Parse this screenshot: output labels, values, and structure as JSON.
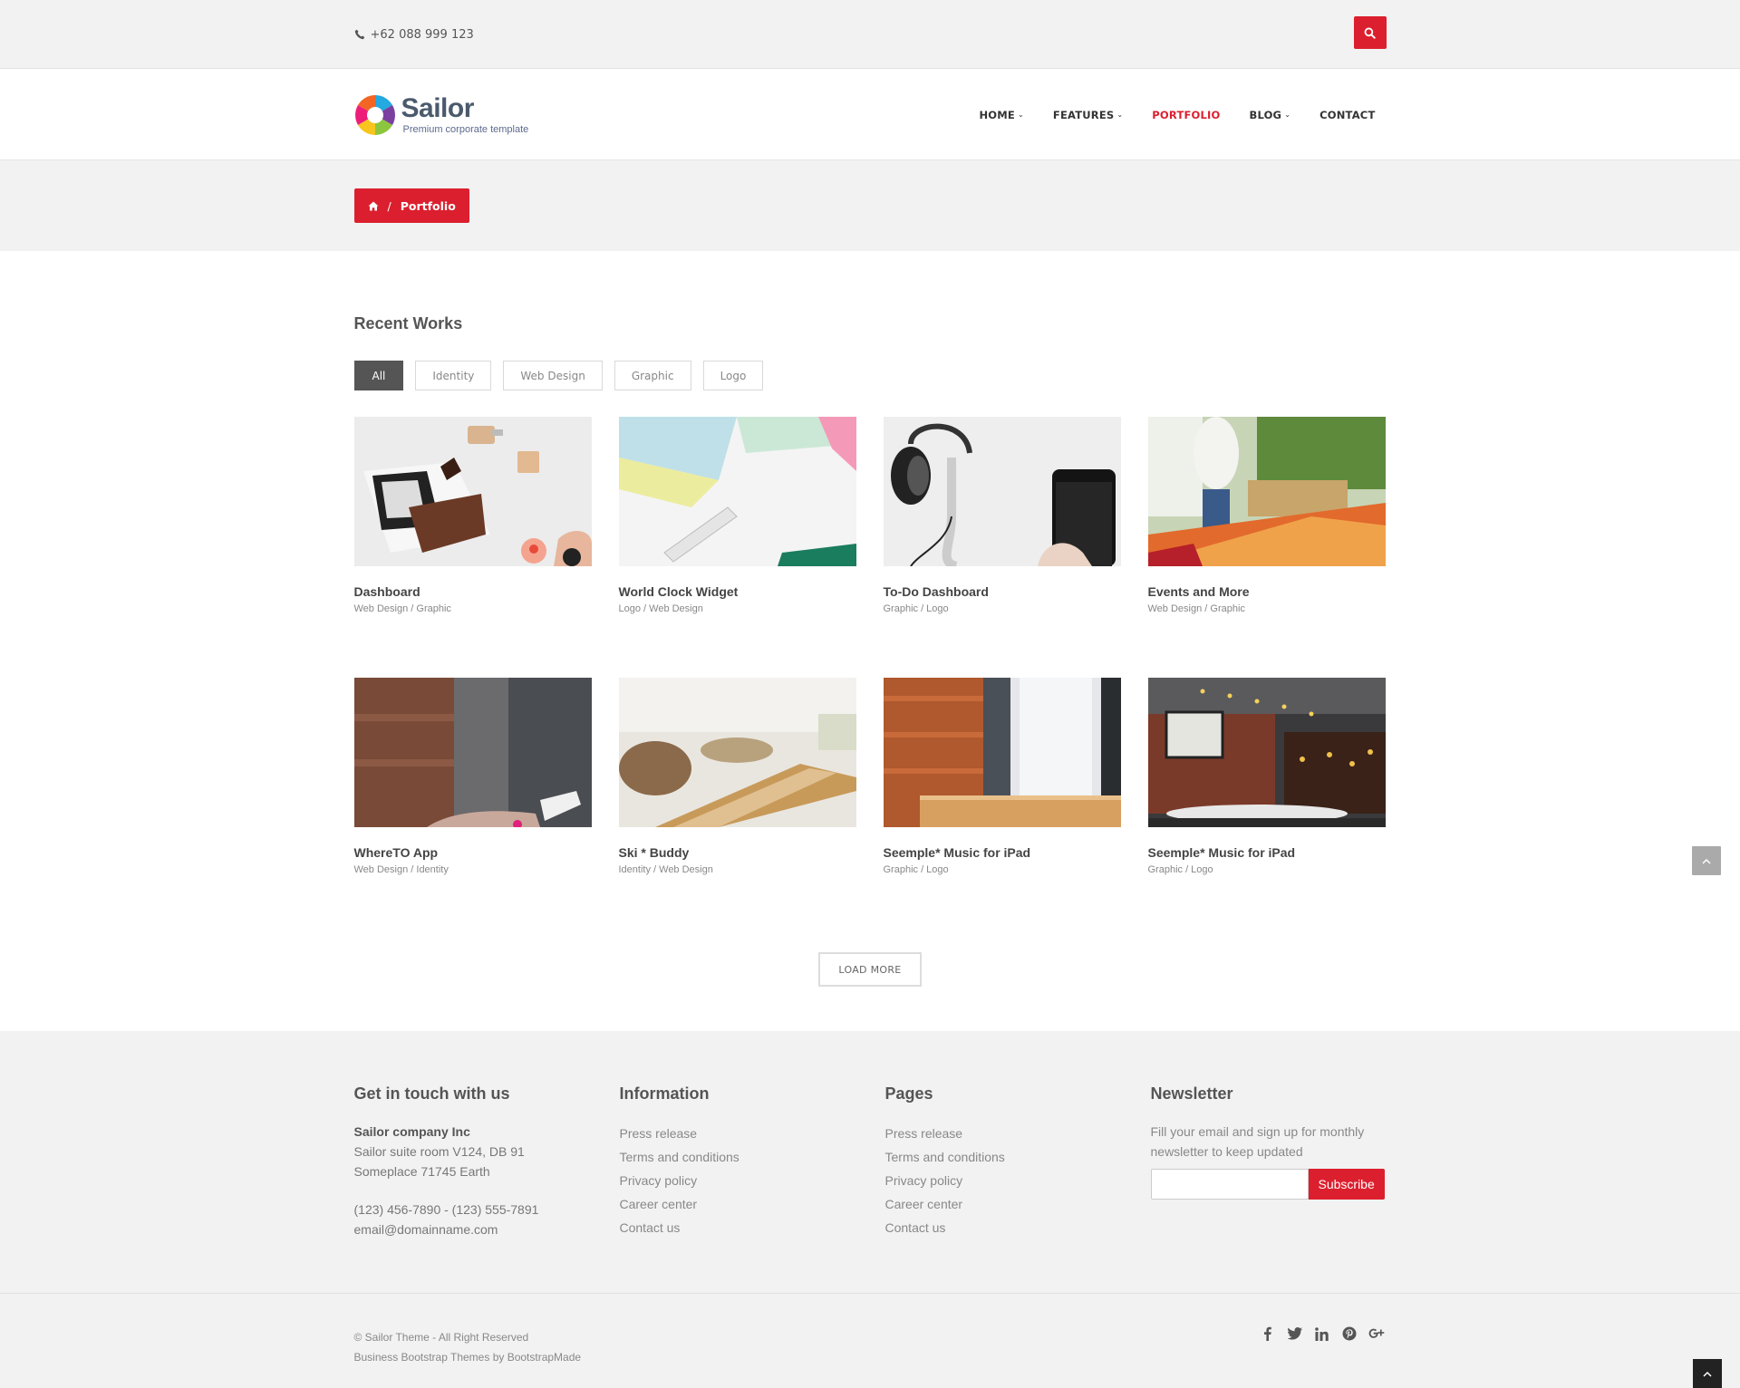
{
  "topbar": {
    "phone": "+62 088 999 123",
    "phone_icon": "phone-icon",
    "search_icon": "search-icon"
  },
  "header": {
    "logo_name": "Sailor",
    "logo_tagline": "Premium corporate template",
    "nav": [
      {
        "label": "HOME",
        "dropdown": true
      },
      {
        "label": "FEATURES",
        "dropdown": true
      },
      {
        "label": "PORTFOLIO",
        "active": true
      },
      {
        "label": "BLOG",
        "dropdown": true
      },
      {
        "label": "CONTACT"
      }
    ]
  },
  "breadcrumb": {
    "home_icon": "home-icon",
    "separator": "/",
    "current": "Portfolio"
  },
  "portfolio": {
    "title": "Recent Works",
    "filters": [
      "All",
      "Identity",
      "Web Design",
      "Graphic",
      "Logo"
    ],
    "active_filter": "All",
    "items": [
      {
        "title": "Dashboard",
        "categories": "Web Design / Graphic"
      },
      {
        "title": "World Clock Widget",
        "categories": "Logo / Web Design"
      },
      {
        "title": "To-Do Dashboard",
        "categories": "Graphic / Logo"
      },
      {
        "title": "Events and More",
        "categories": "Web Design / Graphic"
      },
      {
        "title": "WhereTO App",
        "categories": "Web Design / Identity"
      },
      {
        "title": "Ski * Buddy",
        "categories": "Identity / Web Design"
      },
      {
        "title": "Seemple* Music for iPad",
        "categories": "Graphic / Logo"
      },
      {
        "title": "Seemple* Music for iPad",
        "categories": "Graphic / Logo"
      }
    ],
    "load_more": "LOAD MORE"
  },
  "footer": {
    "contact": {
      "title": "Get in touch with us",
      "company": "Sailor company Inc",
      "address1": "Sailor suite room V124, DB 91",
      "address2": "Someplace 71745 Earth",
      "phones": "(123) 456-7890 - (123) 555-7891",
      "email": "email@domainname.com"
    },
    "information": {
      "title": "Information",
      "links": [
        "Press release",
        "Terms and conditions",
        "Privacy policy",
        "Career center",
        "Contact us"
      ]
    },
    "pages": {
      "title": "Pages",
      "links": [
        "Press release",
        "Terms and conditions",
        "Privacy policy",
        "Career center",
        "Contact us"
      ]
    },
    "newsletter": {
      "title": "Newsletter",
      "text": "Fill your email and sign up for monthly newsletter to keep updated",
      "input_value": "",
      "button": "Subscribe"
    }
  },
  "bottom": {
    "copyright": "© Sailor Theme - All Right Reserved",
    "credit": "Business Bootstrap Themes by BootstrapMade",
    "social_icons": [
      "facebook-icon",
      "twitter-icon",
      "linkedin-icon",
      "pinterest-icon",
      "google-plus-icon"
    ]
  },
  "colors": {
    "accent": "#dc1f2e",
    "band": "#f2f2f2",
    "text": "#555555"
  }
}
